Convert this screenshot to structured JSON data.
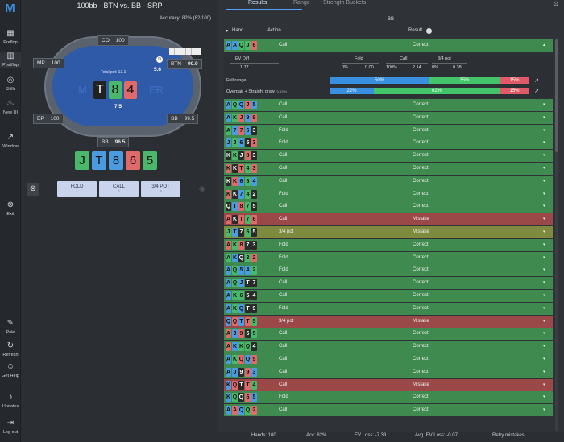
{
  "sidebar": {
    "items": [
      {
        "label": "Preflop",
        "icon": "grid-icon"
      },
      {
        "label": "Postflop",
        "icon": "columns-icon"
      },
      {
        "label": "Skills",
        "icon": "target-icon"
      },
      {
        "label": "New UI",
        "icon": "flame-icon"
      },
      {
        "label": "Window",
        "icon": "external-icon"
      },
      {
        "label": "Exit",
        "icon": "exit-icon"
      },
      {
        "label": "Pale",
        "icon": "brush-icon"
      },
      {
        "label": "Refresh",
        "icon": "refresh-icon"
      },
      {
        "label": "Get Help",
        "icon": "discord-icon"
      },
      {
        "label": "Updates",
        "icon": "bell-icon"
      },
      {
        "label": "Log out",
        "icon": "logout-icon"
      }
    ]
  },
  "left": {
    "title": "100bb - BTN vs. BB - SRP",
    "accuracy": "Accuracy:  82% (82/100)",
    "pot": "Total pot: 13.1",
    "wm_left": "M",
    "wm_right": "ER",
    "btn_bet": "5.6",
    "bb_bet": "7.5",
    "seats": [
      {
        "name": "CO",
        "stack": "100"
      },
      {
        "name": "MP",
        "stack": "100"
      },
      {
        "name": "BTN",
        "stack": "90.9"
      },
      {
        "name": "EP",
        "stack": "100"
      },
      {
        "name": "SB",
        "stack": "99.5"
      },
      {
        "name": "BB",
        "stack": "96.5"
      }
    ],
    "board": [
      {
        "r": "T",
        "c": "#2a2a2a",
        "fc": "#ffffff"
      },
      {
        "r": "8",
        "c": "#4ab86a",
        "fc": "#111"
      },
      {
        "r": "4",
        "c": "#e06a6a",
        "fc": "#111"
      }
    ],
    "hand": [
      {
        "r": "J",
        "c": "#4ab86a"
      },
      {
        "r": "T",
        "c": "#4a9be0"
      },
      {
        "r": "8",
        "c": "#4a9be0"
      },
      {
        "r": "6",
        "c": "#e06a6a"
      },
      {
        "r": "5",
        "c": "#4ab86a"
      }
    ],
    "actions": [
      {
        "label": "FOLD",
        "key": "1"
      },
      {
        "label": "CALL",
        "key": "2"
      },
      {
        "label": "3/4 POT",
        "key": "3"
      }
    ]
  },
  "right": {
    "tabs": [
      "Results",
      "Range",
      "Strength Buckets"
    ],
    "player": "BB",
    "col_hand": "Hand",
    "col_action": "Action",
    "col_result": "Result",
    "expanded": {
      "ev_diff_label": "EV Diff",
      "ev_diff": "1.77",
      "fold_label": "Fold",
      "fold_freq": "0%",
      "fold_ev": "0.00",
      "call_label": "Call",
      "call_freq": "100%",
      "call_ev": "2.14",
      "pot_label": "3/4 pot",
      "pot_freq": "0%",
      "pot_ev": "0.38",
      "full_range": "Full range",
      "fr_bars": [
        "50%",
        "35%",
        "15%"
      ],
      "bucket": "Overpair + Straight draw",
      "bucket_pct": "(0.53%)",
      "bk_bars": [
        "22%",
        "62%",
        "15%"
      ]
    },
    "rows": [
      {
        "cards": [
          [
            "A",
            "#4a9be0"
          ],
          [
            "A",
            "#4a9be0"
          ],
          [
            "Q",
            "#4ab86a"
          ],
          [
            "J",
            "#4ab86a"
          ],
          [
            "6",
            "#e06a6a"
          ]
        ],
        "action": "Call",
        "result": "Correct",
        "color": "green"
      },
      {
        "cards": [
          [
            "A",
            "#4a9be0"
          ],
          [
            "Q",
            "#4ab86a"
          ],
          [
            "Q",
            "#4a9be0"
          ],
          [
            "J",
            "#e06a6a"
          ],
          [
            "5",
            "#4a9be0"
          ]
        ],
        "action": "Call",
        "result": "Correct",
        "color": "green"
      },
      {
        "cards": [
          [
            "A",
            "#4a9be0"
          ],
          [
            "K",
            "#4ab86a"
          ],
          [
            "J",
            "#e06a6a"
          ],
          [
            "9",
            "#4a9be0"
          ],
          [
            "9",
            "#e06a6a"
          ]
        ],
        "action": "Call",
        "result": "Correct",
        "color": "green"
      },
      {
        "cards": [
          [
            "A",
            "#4ab86a"
          ],
          [
            "7",
            "#4a9be0"
          ],
          [
            "7",
            "#e06a6a"
          ],
          [
            "6",
            "#4a9be0"
          ],
          [
            "3",
            "#2a2a2a"
          ]
        ],
        "action": "Fold",
        "result": "Correct",
        "color": "green"
      },
      {
        "cards": [
          [
            "J",
            "#4a9be0"
          ],
          [
            "J",
            "#4ab86a"
          ],
          [
            "6",
            "#4a9be0"
          ],
          [
            "5",
            "#2a2a2a"
          ],
          [
            "3",
            "#e06a6a"
          ]
        ],
        "action": "Fold",
        "result": "Correct",
        "color": "green"
      },
      {
        "cards": [
          [
            "K",
            "#2a2a2a"
          ],
          [
            "K",
            "#4ab86a"
          ],
          [
            "J",
            "#2a2a2a"
          ],
          [
            "8",
            "#e06a6a"
          ],
          [
            "3",
            "#2a2a2a"
          ]
        ],
        "action": "Call",
        "result": "Correct",
        "color": "green"
      },
      {
        "cards": [
          [
            "K",
            "#e06a6a"
          ],
          [
            "K",
            "#2a2a2a"
          ],
          [
            "T",
            "#e06a6a"
          ],
          [
            "4",
            "#4ab86a"
          ],
          [
            "3",
            "#e06a6a"
          ]
        ],
        "action": "Call",
        "result": "Correct",
        "color": "green"
      },
      {
        "cards": [
          [
            "K",
            "#2a2a2a"
          ],
          [
            "K",
            "#e06a6a"
          ],
          [
            "6",
            "#4a9be0"
          ],
          [
            "6",
            "#4ab86a"
          ],
          [
            "4",
            "#4a9be0"
          ]
        ],
        "action": "Call",
        "result": "Correct",
        "color": "green"
      },
      {
        "cards": [
          [
            "K",
            "#e06a6a"
          ],
          [
            "K",
            "#2a2a2a"
          ],
          [
            "7",
            "#4a9be0"
          ],
          [
            "4",
            "#4ab86a"
          ],
          [
            "2",
            "#2a2a2a"
          ]
        ],
        "action": "Fold",
        "result": "Correct",
        "color": "green"
      },
      {
        "cards": [
          [
            "Q",
            "#2a2a2a"
          ],
          [
            "T",
            "#4a9be0"
          ],
          [
            "8",
            "#e06a6a"
          ],
          [
            "7",
            "#4ab86a"
          ],
          [
            "5",
            "#2a2a2a"
          ]
        ],
        "action": "Call",
        "result": "Correct",
        "color": "green"
      },
      {
        "cards": [
          [
            "A",
            "#e06a6a"
          ],
          [
            "K",
            "#2a2a2a"
          ],
          [
            "I",
            "#e06a6a"
          ],
          [
            "7",
            "#4ab86a"
          ],
          [
            "6",
            "#e06a6a"
          ]
        ],
        "action": "Call",
        "result": "Mistake",
        "color": "red"
      },
      {
        "cards": [
          [
            "J",
            "#4ab86a"
          ],
          [
            "T",
            "#4a9be0"
          ],
          [
            "7",
            "#2a2a2a"
          ],
          [
            "6",
            "#4ab86a"
          ],
          [
            "5",
            "#2a2a2a"
          ]
        ],
        "action": "3/4 pot",
        "result": "Mistake",
        "color": "olive"
      },
      {
        "cards": [
          [
            "A",
            "#e06a6a"
          ],
          [
            "K",
            "#4ab86a"
          ],
          [
            "8",
            "#e06a6a"
          ],
          [
            "7",
            "#2a2a2a"
          ],
          [
            "3",
            "#2a2a2a"
          ]
        ],
        "action": "Fold",
        "result": "Correct",
        "color": "green"
      },
      {
        "cards": [
          [
            "A",
            "#4ab86a"
          ],
          [
            "K",
            "#4a9be0"
          ],
          [
            "Q",
            "#2a2a2a"
          ],
          [
            "3",
            "#4ab86a"
          ],
          [
            "2",
            "#e06a6a"
          ]
        ],
        "action": "Fold",
        "result": "Correct",
        "color": "green"
      },
      {
        "cards": [
          [
            "A",
            "#4a9be0"
          ],
          [
            "Q",
            "#4ab86a"
          ],
          [
            "5",
            "#4a9be0"
          ],
          [
            "4",
            "#4a9be0"
          ],
          [
            "2",
            "#4ab86a"
          ]
        ],
        "action": "Fold",
        "result": "Correct",
        "color": "green"
      },
      {
        "cards": [
          [
            "A",
            "#4a9be0"
          ],
          [
            "Q",
            "#4ab86a"
          ],
          [
            "J",
            "#4a9be0"
          ],
          [
            "T",
            "#2a2a2a"
          ],
          [
            "7",
            "#2a2a2a"
          ]
        ],
        "action": "Call",
        "result": "Correct",
        "color": "green"
      },
      {
        "cards": [
          [
            "A",
            "#4a9be0"
          ],
          [
            "K",
            "#4ab86a"
          ],
          [
            "6",
            "#4ab86a"
          ],
          [
            "5",
            "#2a2a2a"
          ],
          [
            "4",
            "#2a2a2a"
          ]
        ],
        "action": "Call",
        "result": "Correct",
        "color": "green"
      },
      {
        "cards": [
          [
            "A",
            "#4a9be0"
          ],
          [
            "K",
            "#4ab86a"
          ],
          [
            "Q",
            "#4a9be0"
          ],
          [
            "T",
            "#2a2a2a"
          ],
          [
            "9",
            "#2a2a2a"
          ]
        ],
        "action": "Fold",
        "result": "Correct",
        "color": "green"
      },
      {
        "cards": [
          [
            "Q",
            "#4a9be0"
          ],
          [
            "Q",
            "#e06a6a"
          ],
          [
            "T",
            "#4a9be0"
          ],
          [
            "T",
            "#e06a6a"
          ],
          [
            "5",
            "#4ab86a"
          ]
        ],
        "action": "3/4 pot",
        "result": "Mistake",
        "color": "red"
      },
      {
        "cards": [
          [
            "A",
            "#e06a6a"
          ],
          [
            "J",
            "#4a9be0"
          ],
          [
            "9",
            "#e06a6a"
          ],
          [
            "5",
            "#2a2a2a"
          ],
          [
            "5",
            "#4ab86a"
          ]
        ],
        "action": "Call",
        "result": "Correct",
        "color": "green"
      },
      {
        "cards": [
          [
            "A",
            "#e06a6a"
          ],
          [
            "K",
            "#4a9be0"
          ],
          [
            "K",
            "#4ab86a"
          ],
          [
            "Q",
            "#4ab86a"
          ],
          [
            "4",
            "#2a2a2a"
          ]
        ],
        "action": "Call",
        "result": "Correct",
        "color": "green"
      },
      {
        "cards": [
          [
            "A",
            "#4a9be0"
          ],
          [
            "K",
            "#4ab86a"
          ],
          [
            "Q",
            "#e06a6a"
          ],
          [
            "Q",
            "#4a9be0"
          ],
          [
            "5",
            "#e06a6a"
          ]
        ],
        "action": "Call",
        "result": "Correct",
        "color": "green"
      },
      {
        "cards": [
          [
            "A",
            "#4a9be0"
          ],
          [
            "J",
            "#4a9be0"
          ],
          [
            "9",
            "#2a2a2a"
          ],
          [
            "9",
            "#e06a6a"
          ],
          [
            "3",
            "#4a9be0"
          ]
        ],
        "action": "Call",
        "result": "Correct",
        "color": "green"
      },
      {
        "cards": [
          [
            "K",
            "#4a9be0"
          ],
          [
            "Q",
            "#e06a6a"
          ],
          [
            "T",
            "#2a2a2a"
          ],
          [
            "T",
            "#e06a6a"
          ],
          [
            "4",
            "#4ab86a"
          ]
        ],
        "action": "Call",
        "result": "Mistake",
        "color": "red"
      },
      {
        "cards": [
          [
            "K",
            "#4a9be0"
          ],
          [
            "Q",
            "#4ab86a"
          ],
          [
            "Q",
            "#2a2a2a"
          ],
          [
            "6",
            "#e06a6a"
          ],
          [
            "5",
            "#4a9be0"
          ]
        ],
        "action": "Fold",
        "result": "Correct",
        "color": "green"
      },
      {
        "cards": [
          [
            "A",
            "#4a9be0"
          ],
          [
            "A",
            "#e06a6a"
          ],
          [
            "Q",
            "#4a9be0"
          ],
          [
            "Q",
            "#4ab86a"
          ],
          [
            "2",
            "#e06a6a"
          ]
        ],
        "action": "Call",
        "result": "Correct",
        "color": "green"
      }
    ]
  },
  "footer": {
    "hands": "Hands: 100",
    "acc": "Acc: 82%",
    "ev_loss": "EV Loss: -7.33",
    "avg_ev": "Avg. EV Loss: -0.07",
    "retry": "Retry mistakes"
  }
}
